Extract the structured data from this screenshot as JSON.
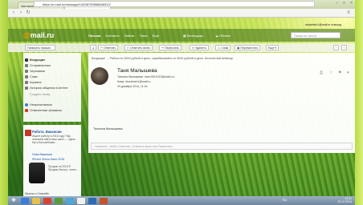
{
  "browser": {
    "tabs": [
      {
        "label": "Автоматизация и ..."
      },
      {
        "label": "Таня Малышева - Вх..."
      }
    ],
    "url": "https://e.mail.ru/message/14536799856668312/"
  },
  "header": {
    "logo_text": "mail.ru",
    "nav": [
      "Письма",
      "Контакты",
      "Файлы",
      "Темы",
      "Ещё"
    ],
    "calendar_label": "Календарь",
    "cloud_label": "Облако",
    "search_placeholder": "Поиск по почте",
    "account": "ntuscherb1@mail.ru ▾ выход"
  },
  "toolbar": {
    "compose": "Написать письмо",
    "buttons": [
      "Ответить",
      "Ответить всем",
      "Переслать",
      "Удалить",
      "Спам",
      "Переместить",
      "Ещё"
    ]
  },
  "sidebar": {
    "items": [
      {
        "label": "Входящие",
        "selected": true
      },
      {
        "label": "Отправленные",
        "selected": false
      },
      {
        "label": "Черновики",
        "selected": false
      },
      {
        "label": "Спам",
        "selected": false
      },
      {
        "label": "Корзина",
        "selected": false
      },
      {
        "label": "История общения в Агенте",
        "selected": false
      },
      {
        "label": "Создать папку",
        "selected": false
      },
      {
        "label": "Непрочитанные",
        "selected": false
      },
      {
        "label": "Отмеченные флажком",
        "selected": false
      }
    ]
  },
  "ad": {
    "title": "Работа. Вакансии",
    "text": "Ищите работу в 2015 году? Мы поможем найти ваш шанс — Здесь быть Востребован...",
    "link": "Нова Вакансия",
    "product": "iPhone Флеш Напо 2015",
    "price": "Продаю за 2015 ₽ Продаю быстро, очень...",
    "footer": "Мысли о Спасибо"
  },
  "message": {
    "breadcrumb": "Входящие → Работа по 3000 рублей в день, зарабатывайте по 5000 рублей в день. Бесплатный вебинар",
    "sender": "Таня Малышева",
    "from_line": "Татьяна Малышева <tan19912013@mail.ru>",
    "to_line": "Кому: ntuscherb1@mail.ru",
    "date": "29 декабря 2014, 11:16",
    "signature": "Татьяна Малышева",
    "reply_placeholder": "Написать, чтобы Ответить, Ответить всем или Переслать"
  },
  "taskbar": {
    "lang": "RU",
    "time": "12:11",
    "date": "29.12.2014"
  },
  "colors": {
    "accent": "#1b53a3",
    "logo_orange": "#ff9a00",
    "sidebar_icon_red": "#d23c2e"
  }
}
